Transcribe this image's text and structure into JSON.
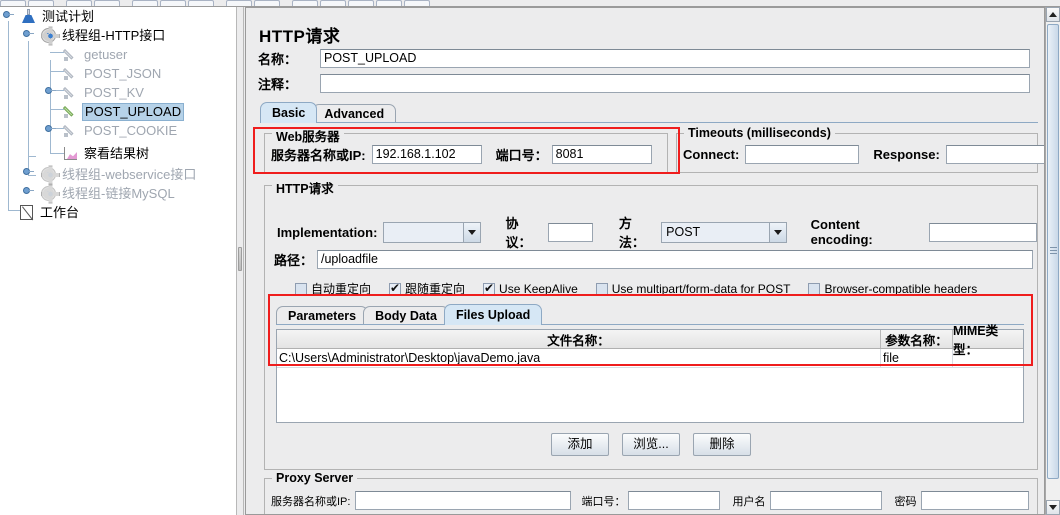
{
  "window": {
    "toolbar_visible": true
  },
  "tree": {
    "nodes": [
      {
        "label": "测试计划",
        "icon": "test-plan-icon",
        "state": "normal"
      },
      {
        "label": "线程组-HTTP接口",
        "icon": "thread-group-icon",
        "state": "normal"
      },
      {
        "label": "getuser",
        "icon": "http-sampler-icon",
        "state": "disabled"
      },
      {
        "label": "POST_JSON",
        "icon": "http-sampler-icon",
        "state": "disabled"
      },
      {
        "label": "POST_KV",
        "icon": "http-sampler-icon",
        "state": "disabled"
      },
      {
        "label": "POST_UPLOAD",
        "icon": "http-sampler-icon",
        "state": "selected"
      },
      {
        "label": "POST_COOKIE",
        "icon": "http-sampler-icon",
        "state": "disabled"
      },
      {
        "label": "察看结果树",
        "icon": "view-results-tree-icon",
        "state": "normal"
      },
      {
        "label": "线程组-webservice接口",
        "icon": "thread-group-icon",
        "state": "disabled"
      },
      {
        "label": "线程组-链接MySQL",
        "icon": "thread-group-icon",
        "state": "disabled"
      },
      {
        "label": "工作台",
        "icon": "workbench-icon",
        "state": "normal"
      }
    ]
  },
  "editor": {
    "title": "HTTP请求",
    "name_label": "名称：",
    "name_value": "POST_UPLOAD",
    "comment_label": "注释：",
    "comment_value": "",
    "tabs": [
      {
        "label": "Basic",
        "active": true
      },
      {
        "label": "Advanced",
        "active": false
      }
    ],
    "web_server": {
      "group_title": "Web服务器",
      "server_label": "服务器名称或IP:",
      "server_value": "192.168.1.102",
      "port_label": "端口号：",
      "port_value": "8081"
    },
    "timeouts": {
      "group_title": "Timeouts (milliseconds)",
      "connect_label": "Connect:",
      "connect_value": "",
      "response_label": "Response:",
      "response_value": ""
    },
    "http_request": {
      "group_title": "HTTP请求",
      "implementation_label": "Implementation:",
      "implementation_value": "",
      "protocol_label": "协议：",
      "protocol_value": "",
      "method_label": "方法：",
      "method_value": "POST",
      "content_encoding_label": "Content encoding:",
      "content_encoding_value": "",
      "path_label": "路径：",
      "path_value": "/uploadfile",
      "checkboxes": [
        {
          "label": "自动重定向",
          "checked": false
        },
        {
          "label": "跟随重定向",
          "checked": true
        },
        {
          "label": "Use KeepAlive",
          "checked": true
        },
        {
          "label": "Use multipart/form-data for POST",
          "checked": false
        },
        {
          "label": "Browser-compatible headers",
          "checked": false
        }
      ],
      "sub_tabs": [
        {
          "label": "Parameters",
          "active": false
        },
        {
          "label": "Body Data",
          "active": false
        },
        {
          "label": "Files Upload",
          "active": true
        }
      ],
      "files_table": {
        "columns": [
          "文件名称：",
          "参数名称：",
          "MIME类型："
        ],
        "rows": [
          [
            "C:\\Users\\Administrator\\Desktop\\javaDemo.java",
            "file",
            ""
          ]
        ]
      },
      "buttons": [
        {
          "label": "添加"
        },
        {
          "label": "浏览..."
        },
        {
          "label": "删除"
        }
      ]
    },
    "proxy_server": {
      "group_title": "Proxy Server",
      "server_label": "服务器名称或IP:",
      "server_value": "",
      "port_label": "端口号：",
      "port_value": "",
      "username_label": "用户名",
      "username_value": "",
      "password_label": "密码",
      "password_value": ""
    }
  },
  "highlights": {
    "accent_color": "#ef1d1d",
    "regions": [
      "web-server-group",
      "files-upload-section"
    ]
  }
}
